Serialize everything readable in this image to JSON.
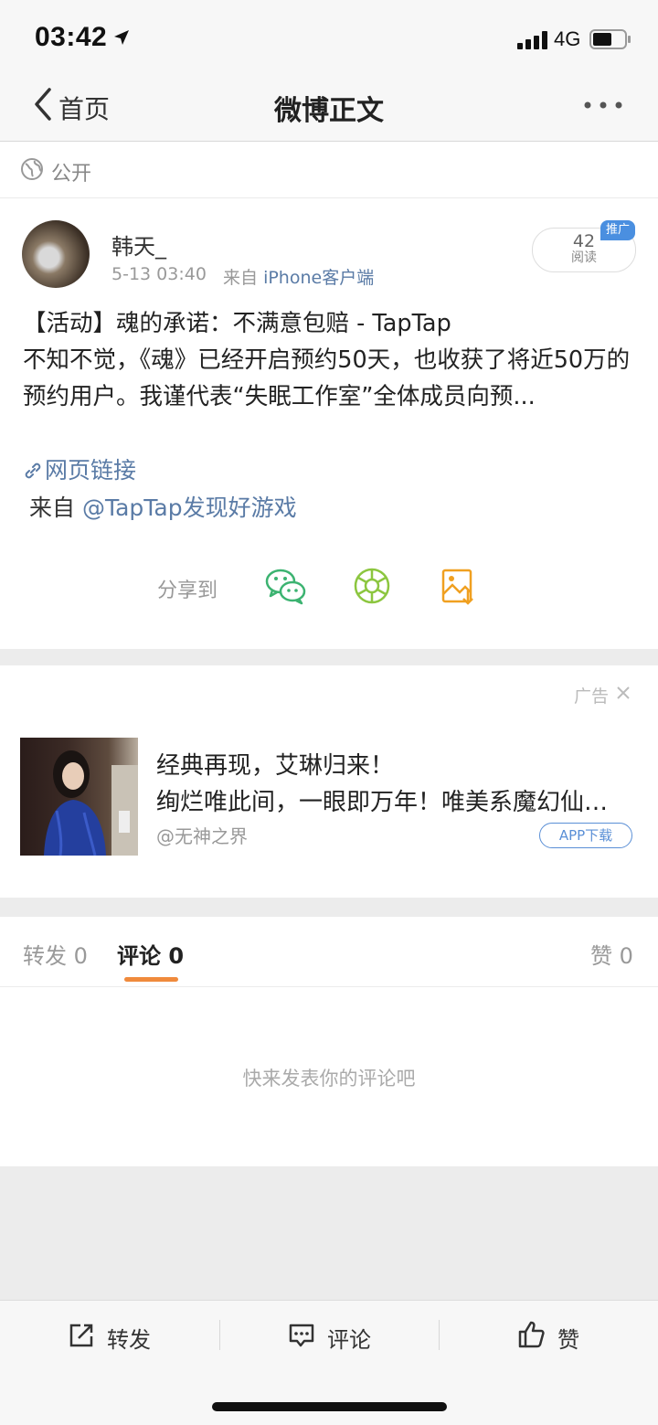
{
  "status_bar": {
    "time": "03:42",
    "network": "4G"
  },
  "nav": {
    "back_label": "首页",
    "title": "微博正文"
  },
  "visibility": {
    "label": "公开"
  },
  "post": {
    "username": "韩天_",
    "time": "5-13 03:40",
    "source_prefix": "来自",
    "source_app": "iPhone客户端",
    "read_count": "42",
    "read_label": "阅读",
    "promo_tag": "推广",
    "text": "【活动】魂的承诺：不满意包赔 - TapTap\n不知不觉，《魂》已经开启预约50天，也收获了将近50万的预约用户。我谨代表“失眠工作室”全体成员向预...",
    "link_label": "网页链接",
    "from_prefix": "来自",
    "from_mention": "@TapTap发现好游戏",
    "share_label": "分享到"
  },
  "ad": {
    "label": "广告",
    "title": "经典再现，艾琳归来！",
    "description": "绚烂唯此间，一眼即万年！唯美系魔幻仙侠手游",
    "advertiser": "@无神之界",
    "button_label": "APP下载"
  },
  "tabs": {
    "repost": "转发 0",
    "comment": "评论 0",
    "like": "赞 0",
    "active": "comment",
    "accent_color": "#f08a3c"
  },
  "comments": {
    "empty_hint": "快来发表你的评论吧"
  },
  "toolbar": {
    "repost": "转发",
    "comment": "评论",
    "like": "赞"
  },
  "colors": {
    "link": "#5a7ba6",
    "promo": "#4a8fe0",
    "wechat": "#3cb371",
    "moments": "#8cc63f",
    "album": "#f0a020"
  },
  "icons": [
    "location-arrow-icon",
    "signal-icon",
    "battery-icon",
    "back-chevron-icon",
    "more-icon",
    "globe-icon",
    "link-icon",
    "wechat-icon",
    "moments-icon",
    "album-icon",
    "close-icon",
    "repost-icon",
    "comment-icon",
    "like-icon"
  ]
}
